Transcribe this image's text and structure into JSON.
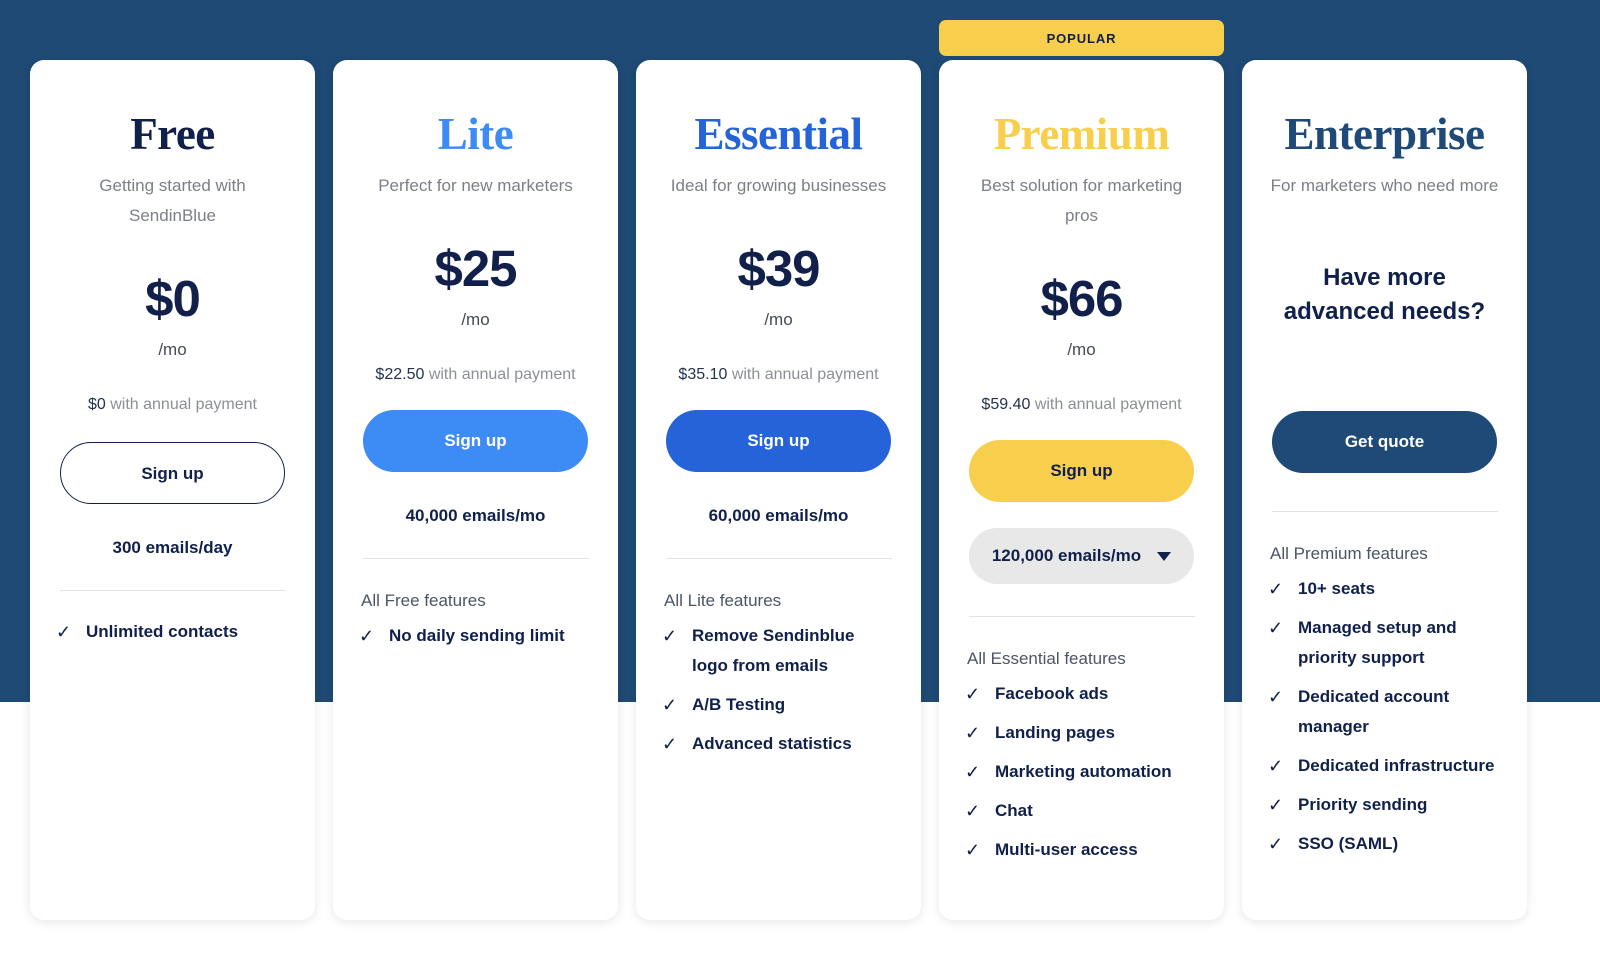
{
  "colors": {
    "background_navy": "#1e4a75",
    "dark_navy_text": "#10204a",
    "lite_blue": "#3d8bf5",
    "essential_blue": "#2563d8",
    "premium_yellow": "#f7cf4d",
    "enterprise_navy": "#1f4a78"
  },
  "badge": {
    "label": "POPULAR"
  },
  "plans": [
    {
      "name": "Free",
      "tagline": "Getting started with SendinBlue",
      "price": "$0",
      "period": "/mo",
      "annual_amount": "$0",
      "annual_suffix": "with annual payment",
      "cta_label": "Sign up",
      "quota": "300 emails/day",
      "feature_intro": "",
      "features": [
        "Unlimited contacts"
      ]
    },
    {
      "name": "Lite",
      "tagline": "Perfect for new marketers",
      "price": "$25",
      "period": "/mo",
      "annual_amount": "$22.50",
      "annual_suffix": "with annual payment",
      "cta_label": "Sign up",
      "quota": "40,000 emails/mo",
      "feature_intro": "All Free features",
      "features": [
        "No daily sending limit"
      ]
    },
    {
      "name": "Essential",
      "tagline": "Ideal for growing businesses",
      "price": "$39",
      "period": "/mo",
      "annual_amount": "$35.10",
      "annual_suffix": "with annual payment",
      "cta_label": "Sign up",
      "quota": "60,000 emails/mo",
      "feature_intro": "All Lite features",
      "features": [
        "Remove Sendinblue logo from emails",
        "A/B Testing",
        "Advanced statistics"
      ]
    },
    {
      "name": "Premium",
      "tagline": "Best solution for marketing pros",
      "price": "$66",
      "period": "/mo",
      "annual_amount": "$59.40",
      "annual_suffix": "with annual payment",
      "cta_label": "Sign up",
      "quota_selected": "120,000 emails/mo",
      "feature_intro": "All Essential features",
      "features": [
        "Facebook ads",
        "Landing pages",
        "Marketing automation",
        "Chat",
        "Multi-user access"
      ]
    },
    {
      "name": "Enterprise",
      "tagline": "For marketers who need more",
      "headline": "Have more advanced needs?",
      "cta_label": "Get quote",
      "feature_intro": "All Premium features",
      "features": [
        "10+ seats",
        "Managed setup and priority support",
        "Dedicated account manager",
        "Dedicated infrastructure",
        "Priority sending",
        "SSO (SAML)"
      ]
    }
  ],
  "icons": {
    "check": "✓",
    "caret_down": "caret-down-icon"
  }
}
